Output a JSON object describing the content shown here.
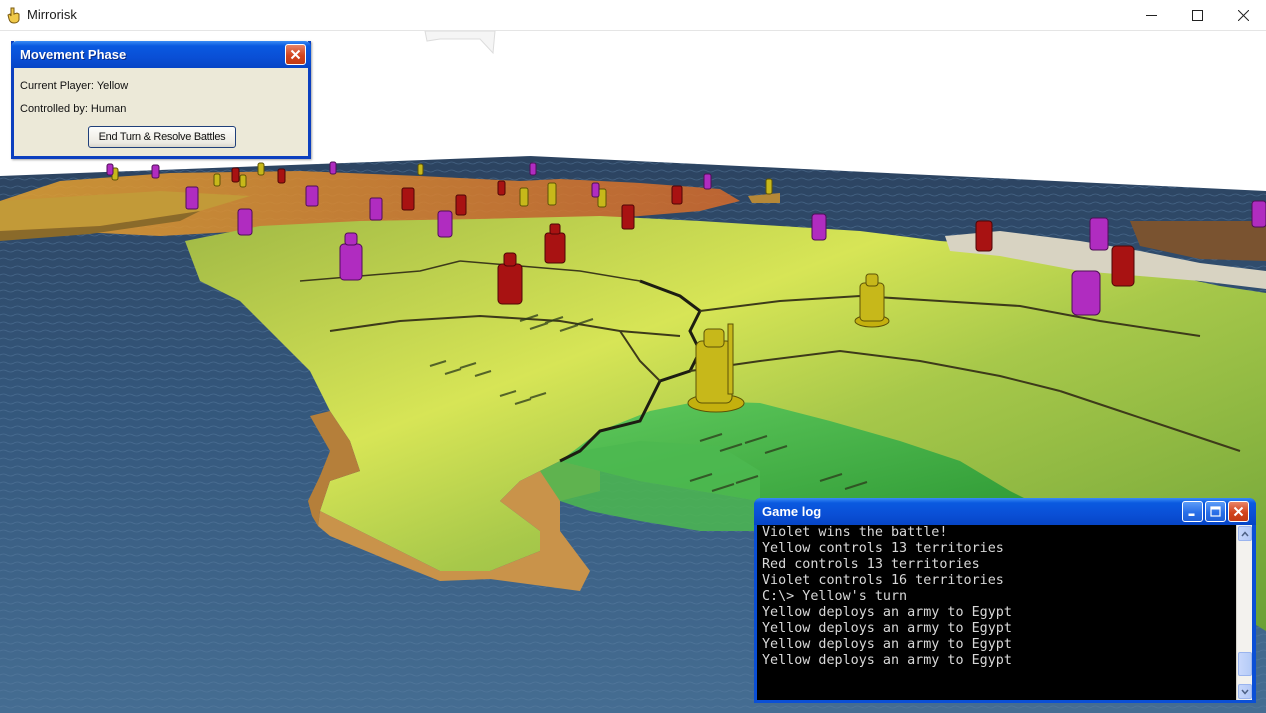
{
  "window": {
    "title": "Mirrorisk",
    "icon": "hand-icon",
    "controls": [
      "minimize-icon",
      "maximize-icon",
      "close-icon"
    ]
  },
  "phase_panel": {
    "title": "Movement Phase",
    "current_player": "Current Player: Yellow",
    "controlled_by": "Controlled by: Human",
    "end_turn_label": "End Turn & Resolve Battles"
  },
  "game_log": {
    "title": "Game log",
    "lines": [
      "Violet wins the battle!",
      "Yellow controls 13 territories",
      "Red controls 13 territories",
      "Violet controls 16 territories",
      "C:\\> Yellow's turn",
      "Yellow deploys an army to Egypt",
      "Yellow deploys an army to Egypt",
      "Yellow deploys an army to Egypt",
      "Yellow deploys an army to Egypt"
    ],
    "scroll_position": 0.95
  },
  "colors": {
    "xp_blue": "#0a4fd6",
    "yellow_player": "#d8c418",
    "red_player": "#b51414",
    "violet_player": "#b52fc2",
    "ocean": "#2e4a6b"
  }
}
